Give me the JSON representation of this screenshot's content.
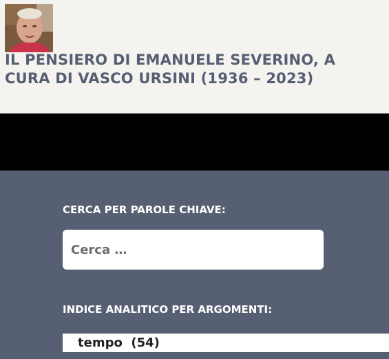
{
  "header": {
    "site_title": "IL PENSIERO DI EMANUELE SEVERINO, A CURA DI VASCO URSINI (1936 – 2023)"
  },
  "sidebar": {
    "search_widget": {
      "title": "CERCA PER PAROLE CHIAVE:",
      "placeholder": "Cerca …"
    },
    "index_widget": {
      "title": "INDICE ANALITICO PER ARGOMENTI:",
      "items": [
        {
          "label": "tempo",
          "count": "(54)"
        }
      ]
    }
  }
}
